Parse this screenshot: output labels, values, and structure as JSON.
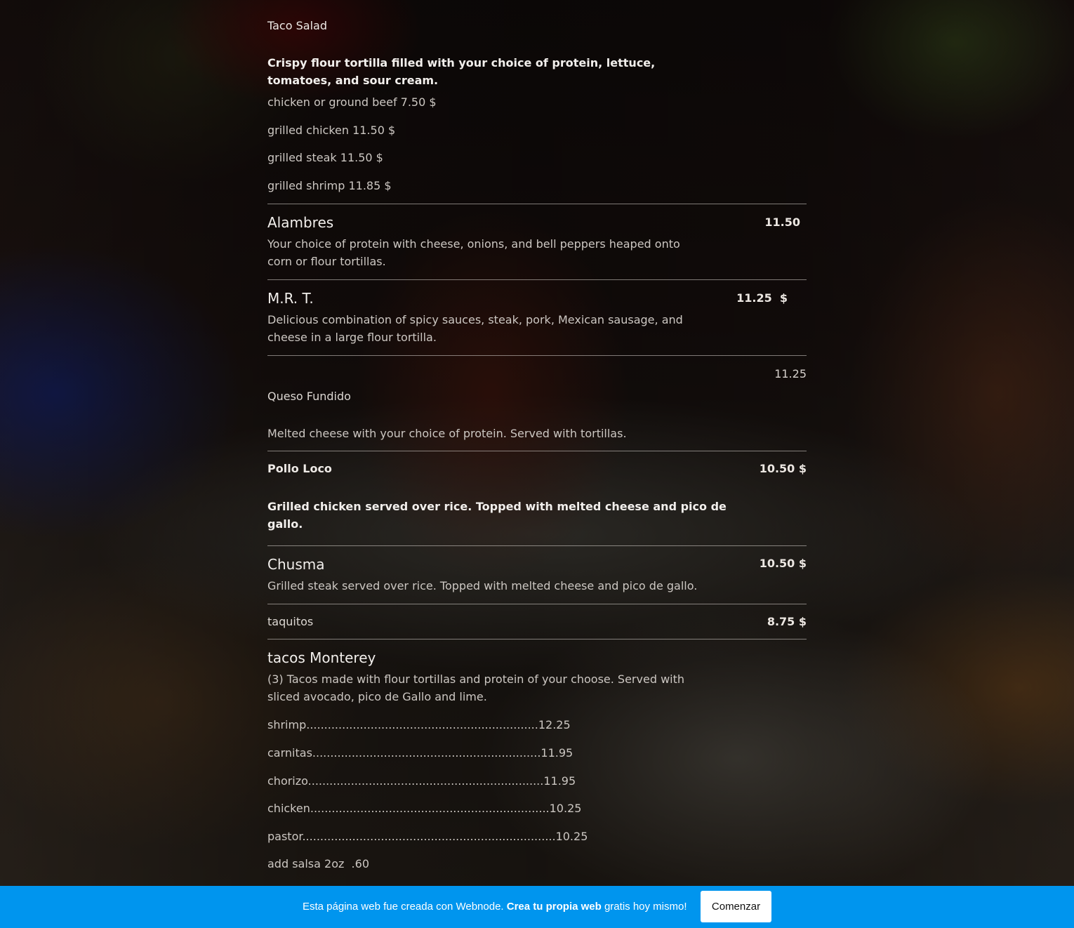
{
  "menu": {
    "taco_salad": {
      "title": "Taco Salad",
      "description": "Crispy flour tortilla filled with your choice of protein, lettuce, tomatoes, and sour cream.",
      "options": [
        "chicken or ground beef  7.50  $",
        "grilled chicken 11.50 $",
        "grilled steak 11.50 $",
        "grilled shrimp 11.85 $"
      ]
    },
    "alambres": {
      "title": "Alambres",
      "price": "11.50",
      "description": "Your choice of protein with  cheese, onions, and bell peppers heaped onto corn or flour tortillas."
    },
    "mrt": {
      "title": "M.R. T.",
      "price": "11.25  $",
      "description": "Delicious combination of spicy sauces, steak, pork, Mexican sausage, and cheese in a large flour tortilla."
    },
    "queso_fundido": {
      "title": "Queso Fundido",
      "price": "11.25",
      "description": "Melted cheese with your choice of protein. Served with tortillas."
    },
    "pollo_loco": {
      "title": "Pollo Loco",
      "price": "10.50 $",
      "description": "Grilled chicken served over rice. Topped with melted cheese and pico de gallo."
    },
    "chusma": {
      "title": "Chusma",
      "price": "10.50 $",
      "description": "Grilled steak served over rice. Topped with melted cheese and pico de gallo."
    },
    "taquitos": {
      "title": "taquitos",
      "price": "8.75 $"
    },
    "tacos_monterey": {
      "title": "tacos Monterey",
      "description": "(3) Tacos made with flour tortillas and protein of your choose. Served with sliced avocado, pico de Gallo and lime.",
      "options": [
        "shrimp.................................................................12.25",
        "carnitas................................................................11.95",
        "chorizo..................................................................11.95",
        "chicken...................................................................10.25",
        "pastor.......................................................................10.25",
        "add salsa 2oz  .60"
      ]
    }
  },
  "banner": {
    "text_prefix": "Esta página web fue creada con Webnode.",
    "text_bold": "Crea tu propia web",
    "text_suffix": "gratis hoy mismo!",
    "button_label": "Comenzar",
    "background_color": "#0095ee"
  }
}
